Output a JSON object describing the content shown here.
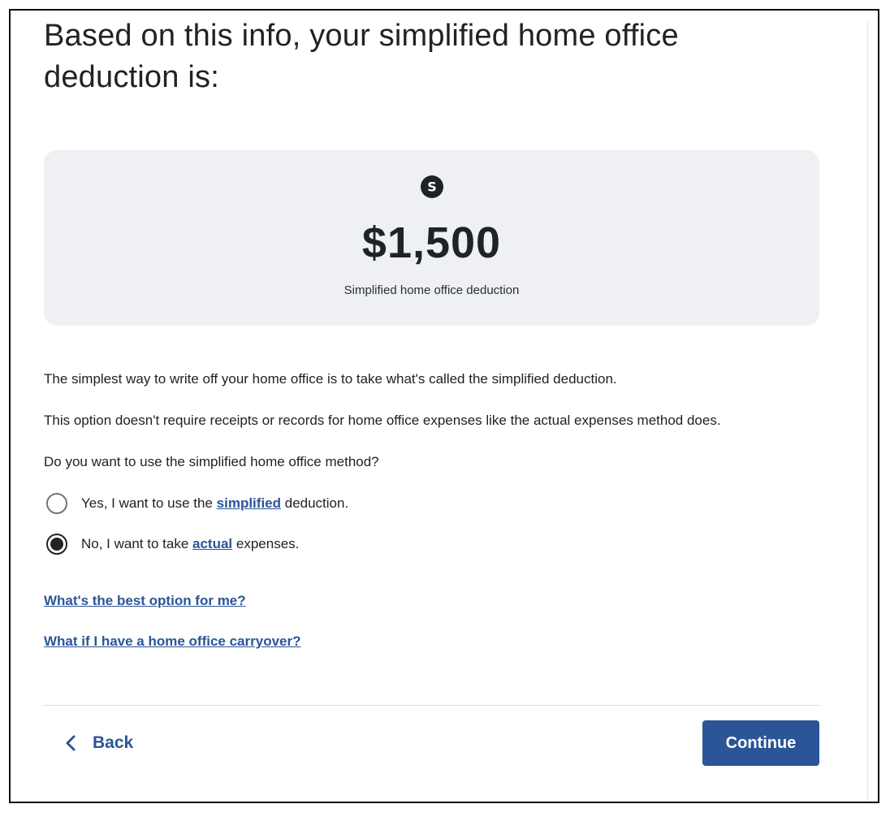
{
  "heading": "Based on this info, your simplified home office deduction is:",
  "card": {
    "icon": "dollar-icon",
    "amount": "$1,500",
    "label": "Simplified home office deduction"
  },
  "paragraphs": [
    "The simplest way to write off your home office is to take what's called the simplified deduction.",
    "This option doesn't require receipts or records for home office expenses like the actual expenses method does.",
    "Do you want to use the simplified home office method?"
  ],
  "options": [
    {
      "before": "Yes, I want to use the ",
      "link": "simplified",
      "after": " deduction.",
      "selected": false
    },
    {
      "before": "No, I want to take ",
      "link": "actual",
      "after": " expenses.",
      "selected": true
    }
  ],
  "help_links": [
    "What's the best option for me?",
    "What if I have a home office carryover?"
  ],
  "footer": {
    "back_label": "Back",
    "continue_label": "Continue"
  },
  "colors": {
    "accent": "#2b5597",
    "card_bg": "#eef0f3",
    "text": "#1f2328"
  }
}
